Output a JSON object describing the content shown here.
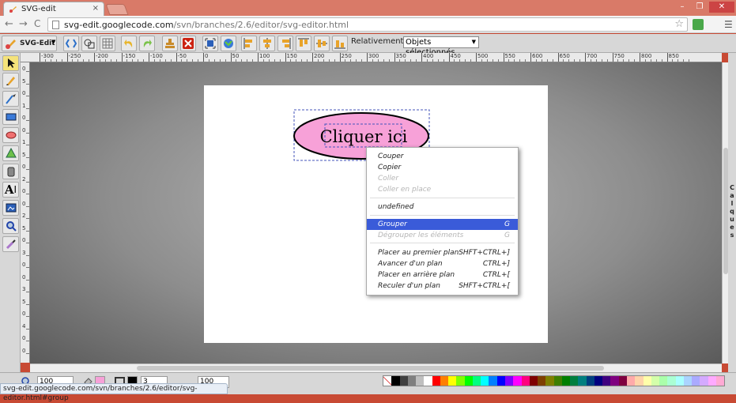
{
  "browser": {
    "tab_title": "SVG-edit",
    "tab_close": "×",
    "url_host": "svg-edit.googlecode.com",
    "url_path": "/svn/branches/2.6/editor/svg-editor.html",
    "back": "←",
    "forward": "→",
    "reload": "C",
    "star": "☆",
    "menu": "☰",
    "min": "–",
    "max": "❐",
    "close": "✕"
  },
  "toolbar": {
    "app_label": "SVG-Edit",
    "relative_label": "Relativement à:",
    "relative_value": "Objets sélectionnés"
  },
  "ruler": {
    "h_ticks": [
      "-300",
      "-250",
      "-200",
      "-150",
      "-100",
      "-50",
      "0",
      "50",
      "100",
      "150",
      "200",
      "250",
      "300",
      "350",
      "400",
      "450",
      "500",
      "550",
      "600",
      "650",
      "700",
      "750",
      "800",
      "850"
    ],
    "v_ticks": [
      "0",
      "5",
      "0",
      "1",
      "0",
      "0",
      "1",
      "5",
      "0",
      "2",
      "0",
      "0",
      "2",
      "5",
      "0",
      "3",
      "0",
      "0",
      "3",
      "5",
      "0",
      "4",
      "0",
      "0"
    ]
  },
  "canvas": {
    "button_text": "Cliquer ici",
    "ellipse_fill": "#f7a1d8"
  },
  "context_menu": {
    "items": [
      {
        "label": "Couper",
        "shortcut": "",
        "disabled": false
      },
      {
        "label": "Copier",
        "shortcut": "",
        "disabled": false
      },
      {
        "label": "Coller",
        "shortcut": "",
        "disabled": true
      },
      {
        "label": "Coller en place",
        "shortcut": "",
        "disabled": true
      },
      {
        "label": "undefined",
        "shortcut": "",
        "disabled": false
      },
      {
        "label": "Grouper",
        "shortcut": "G",
        "disabled": false,
        "highlighted": true
      },
      {
        "label": "Dégrouper les éléments",
        "shortcut": "G",
        "disabled": true
      },
      {
        "label": "Placer au premier plan",
        "shortcut": "SHFT+CTRL+]",
        "disabled": false
      },
      {
        "label": "Avancer d'un plan",
        "shortcut": "CTRL+]",
        "disabled": false
      },
      {
        "label": "Placer en arrière plan",
        "shortcut": "CTRL+[",
        "disabled": false
      },
      {
        "label": "Reculer d'un plan",
        "shortcut": "SHFT+CTRL+[",
        "disabled": false
      }
    ]
  },
  "layers_label": "Calques",
  "bottom": {
    "zoom_value": "100",
    "stroke_width": "3",
    "opacity_value": "100",
    "fill_color": "#f7a1d8",
    "stroke_color": "#000000"
  },
  "palette": [
    "#000000",
    "#3f3f3f",
    "#7f7f7f",
    "#bfbfbf",
    "#ffffff",
    "#ff0000",
    "#ff7f00",
    "#ffff00",
    "#7fff00",
    "#00ff00",
    "#00ff7f",
    "#00ffff",
    "#007fff",
    "#0000ff",
    "#7f00ff",
    "#ff00ff",
    "#ff007f",
    "#7f0000",
    "#7f3f00",
    "#7f7f00",
    "#3f7f00",
    "#007f00",
    "#007f3f",
    "#007f7f",
    "#003f7f",
    "#00007f",
    "#3f007f",
    "#7f007f",
    "#7f003f",
    "#ffaaaa",
    "#ffd4aa",
    "#ffffaa",
    "#d4ffaa",
    "#aaffaa",
    "#aaffd4",
    "#aaffff",
    "#aad4ff",
    "#aaaaff",
    "#d4aaff",
    "#ffaaff",
    "#ffaad4"
  ],
  "status_text": "svg-edit.googlecode.com/svn/branches/2.6/editor/svg-editor.html#group"
}
